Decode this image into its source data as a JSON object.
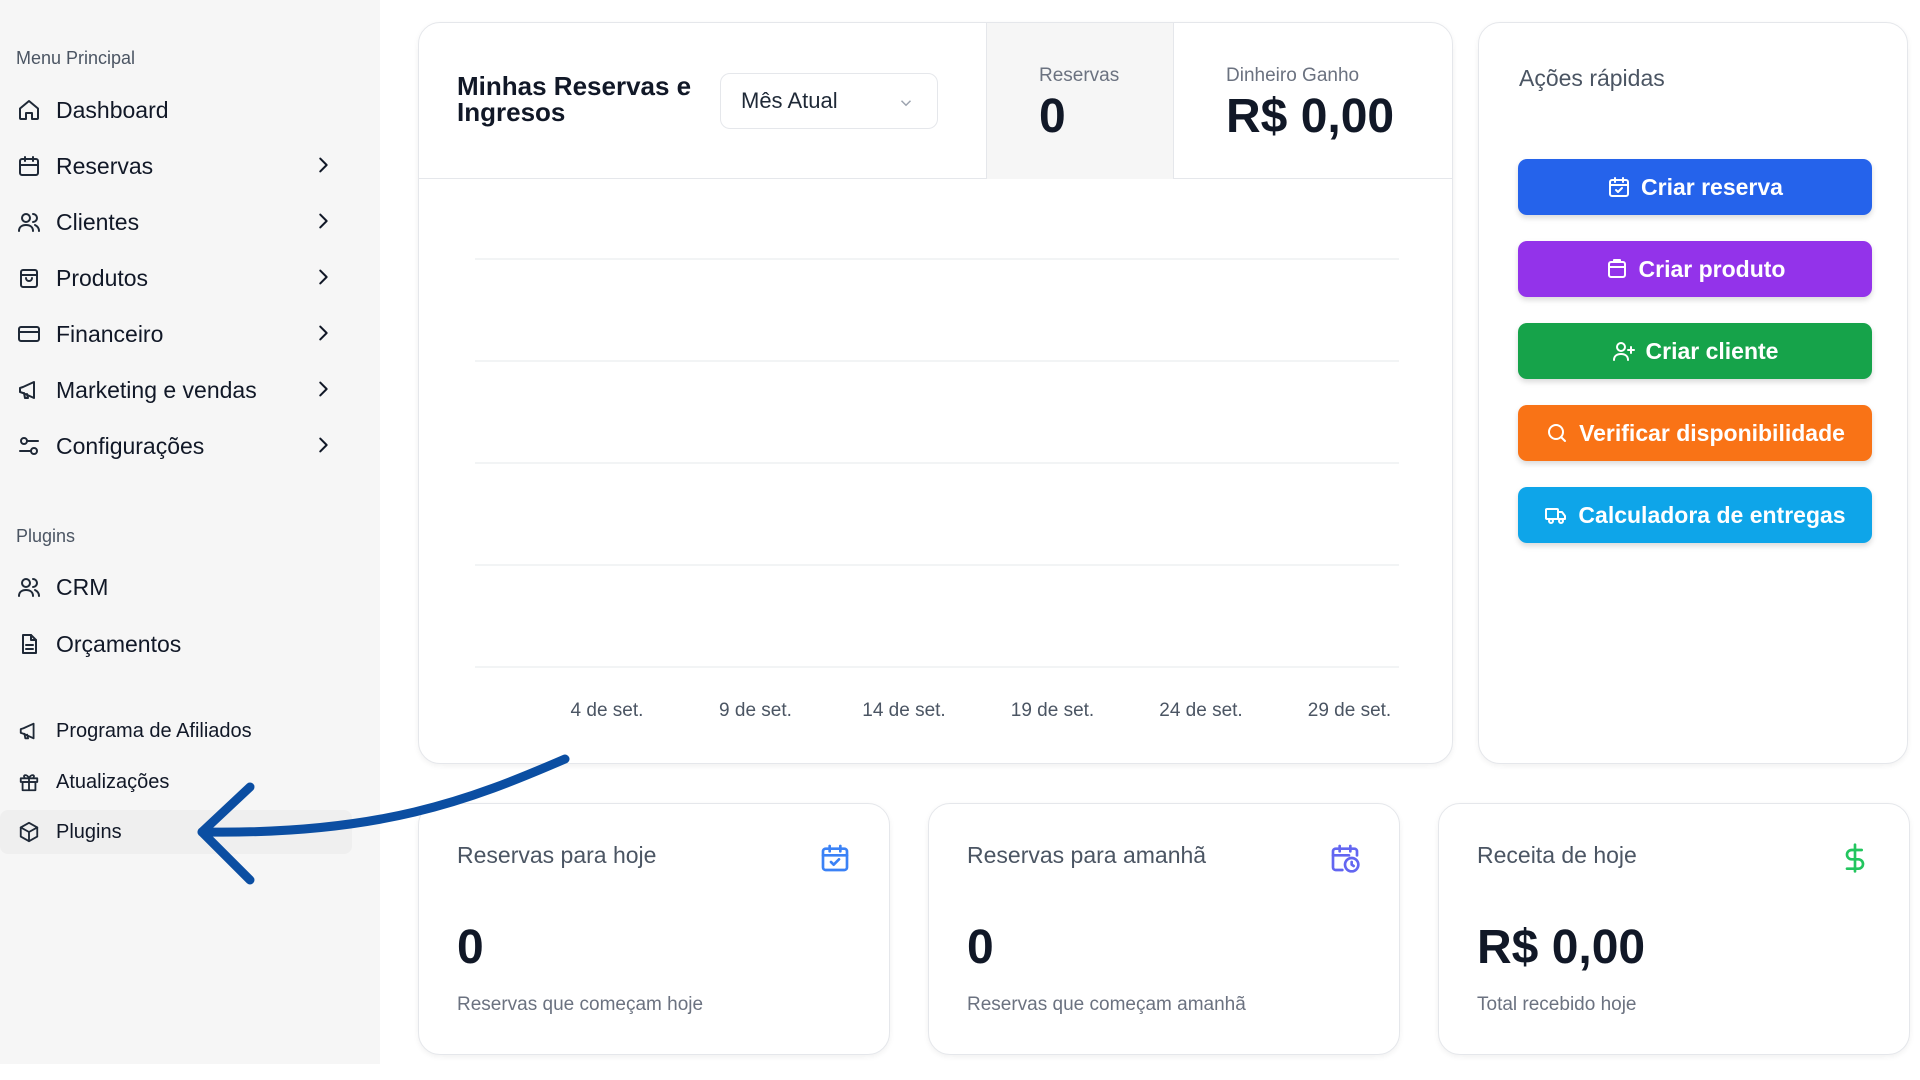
{
  "sidebar": {
    "main_title": "Menu Principal",
    "items": [
      {
        "label": "Dashboard"
      },
      {
        "label": "Reservas"
      },
      {
        "label": "Clientes"
      },
      {
        "label": "Produtos"
      },
      {
        "label": "Financeiro"
      },
      {
        "label": "Marketing e vendas"
      },
      {
        "label": "Configurações"
      }
    ],
    "plugins_title": "Plugins",
    "plugin_items": [
      {
        "label": "CRM"
      },
      {
        "label": "Orçamentos"
      }
    ],
    "extra_items": [
      {
        "label": "Programa de Afiliados"
      },
      {
        "label": "Atualizações"
      },
      {
        "label": "Plugins"
      }
    ]
  },
  "main_card": {
    "title": "Minhas Reservas e Ingresos",
    "period_selected": "Mês Atual",
    "reservas_label": "Reservas",
    "reservas_value": "0",
    "money_label": "Dinheiro Ganho",
    "money_value": "R$ 0,00"
  },
  "chart_data": {
    "type": "line",
    "x": [
      "4 de set.",
      "9 de set.",
      "14 de set.",
      "19 de set.",
      "24 de set.",
      "29 de set."
    ],
    "series": [],
    "grid": true
  },
  "quick_actions": {
    "title": "Ações rápidas",
    "buttons": [
      {
        "label": "Criar reserva",
        "color": "#2563eb"
      },
      {
        "label": "Criar produto",
        "color": "#9333ea"
      },
      {
        "label": "Criar cliente",
        "color": "#16a34a"
      },
      {
        "label": "Verificar disponibilidade",
        "color": "#f97316"
      },
      {
        "label": "Calculadora de entregas",
        "color": "#0ea5e9"
      }
    ]
  },
  "stats": [
    {
      "title": "Reservas para hoje",
      "value": "0",
      "subtitle": "Reservas que começam hoje",
      "icon": "calendar-check-icon",
      "icon_color": "#3b82f6"
    },
    {
      "title": "Reservas para amanhã",
      "value": "0",
      "subtitle": "Reservas que começam amanhã",
      "icon": "calendar-clock-icon",
      "icon_color": "#6366f1"
    },
    {
      "title": "Receita de hoje",
      "value": "R$ 0,00",
      "subtitle": "Total recebido hoje",
      "icon": "dollar-icon",
      "icon_color": "#22c55e"
    }
  ],
  "annotation": {
    "arrow_color": "#0b4ea2"
  }
}
